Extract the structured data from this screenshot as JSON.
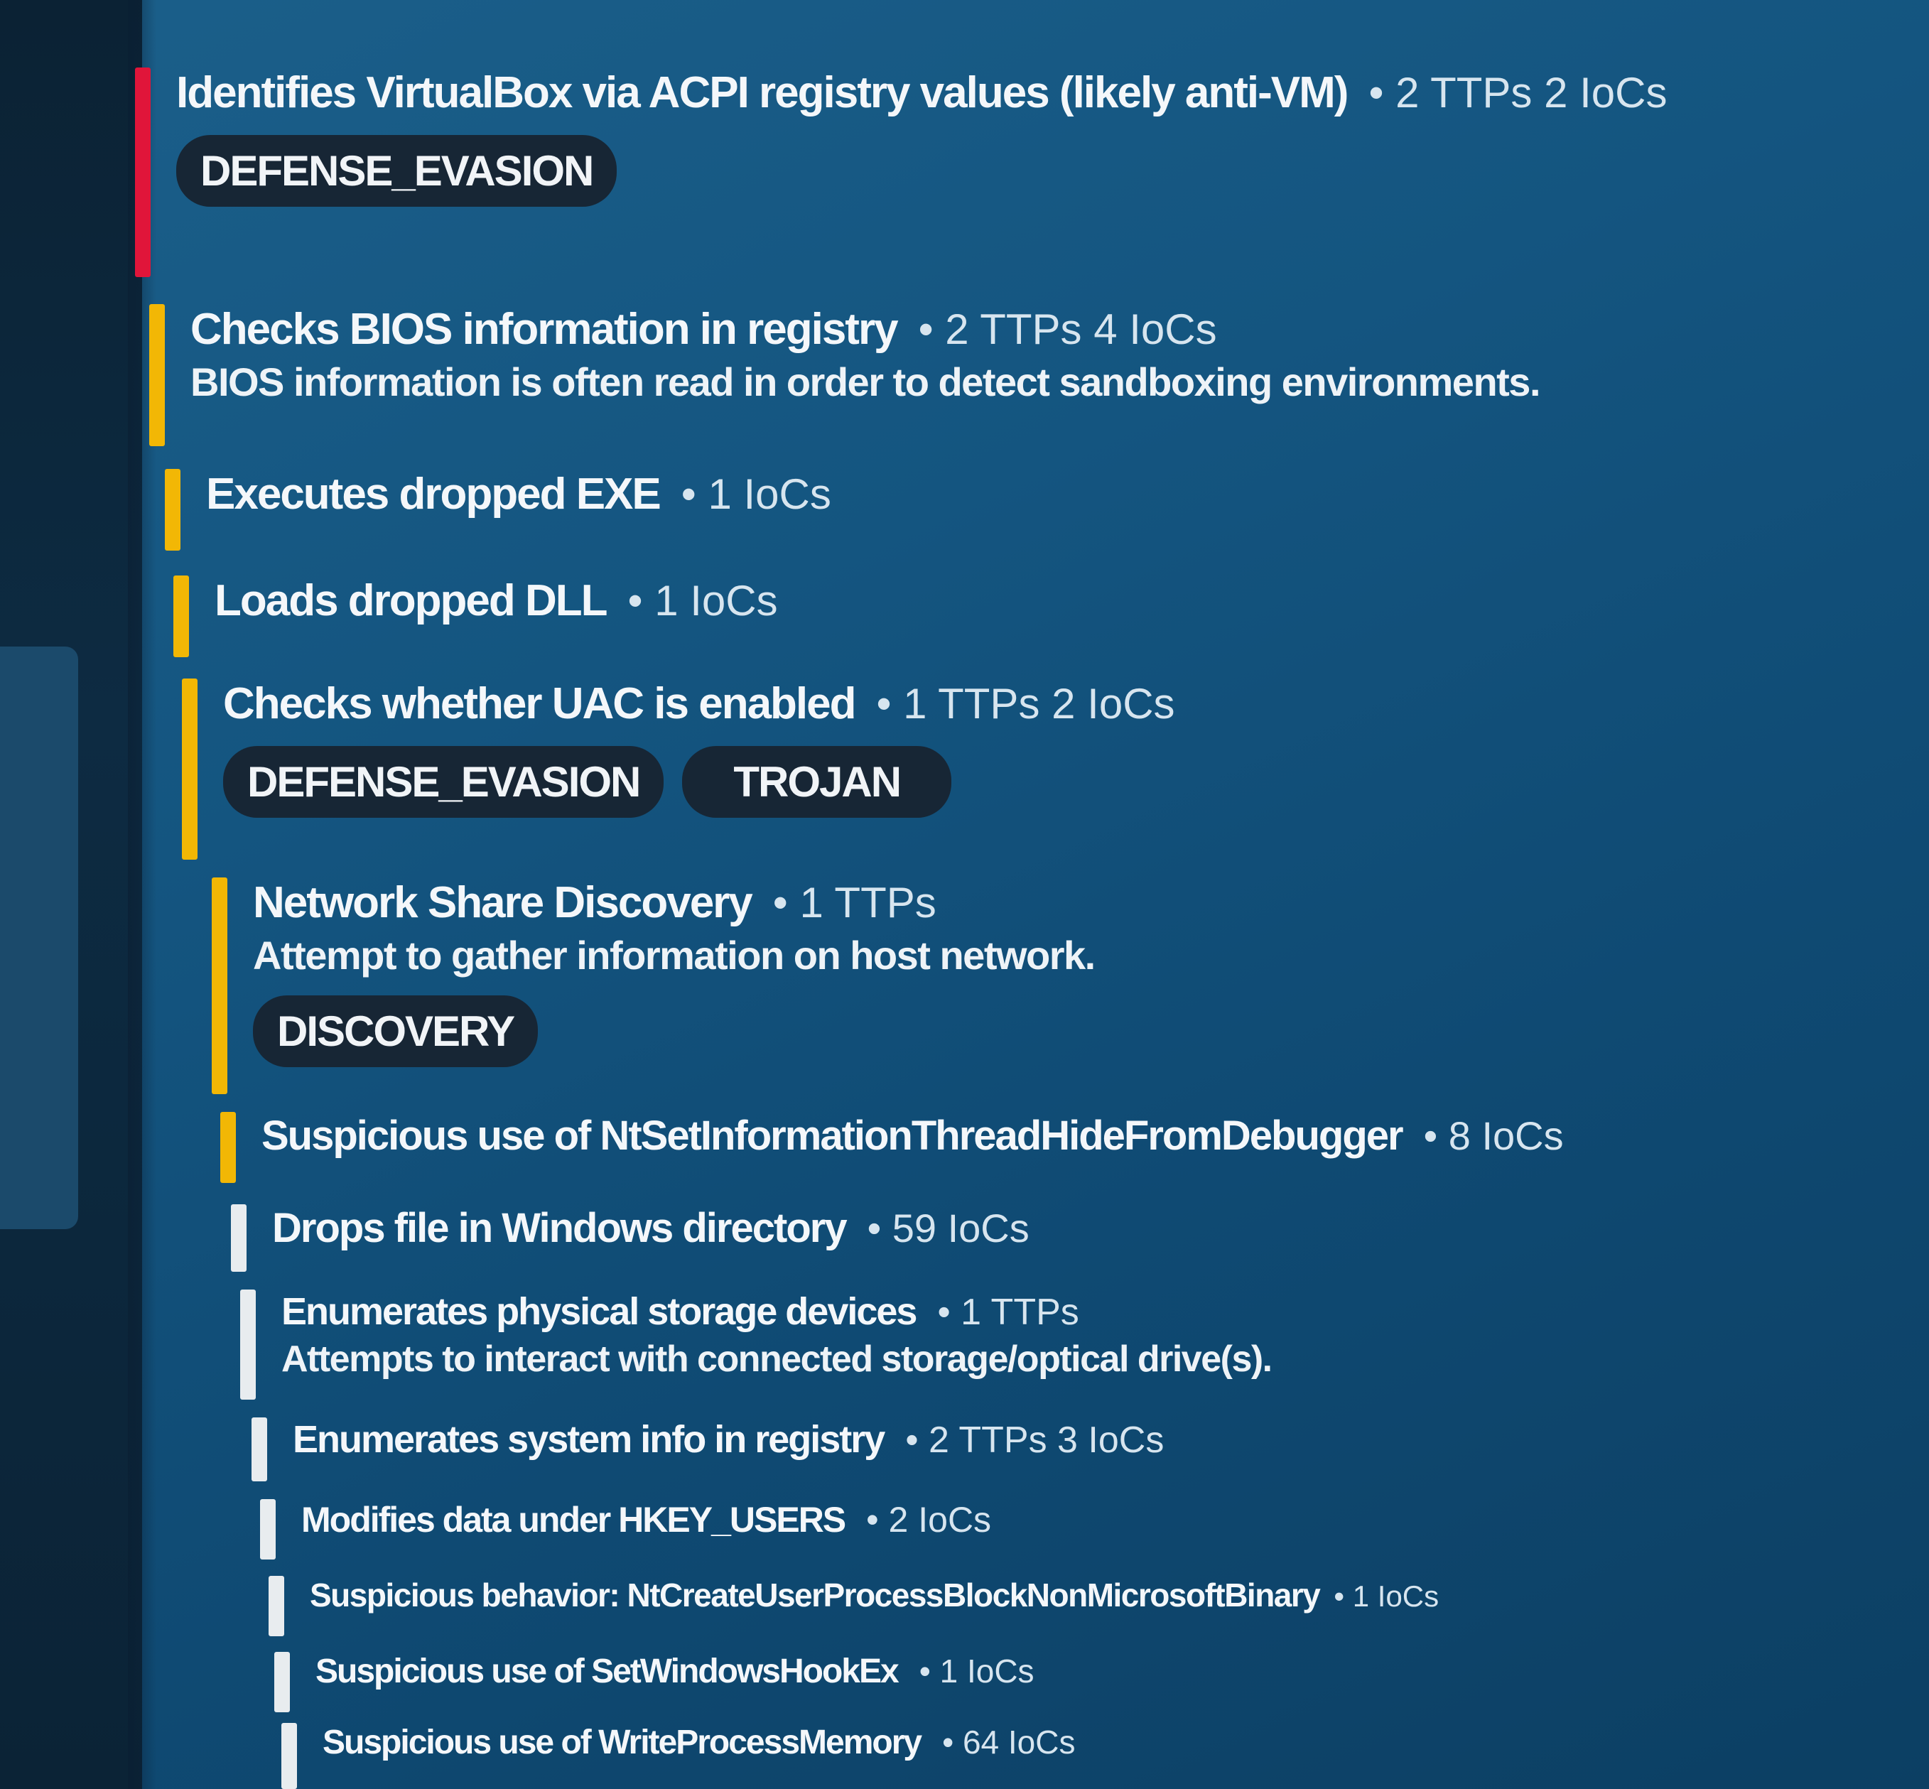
{
  "signatures": [
    {
      "title": "Identifies VirtualBox via ACPI registry values (likely anti-VM)",
      "meta": "• 2 TTPs 2 IoCs",
      "desc": "",
      "tags": [
        "DEFENSE_EVASION"
      ],
      "severity_color": "#e0153a"
    },
    {
      "title": "Checks BIOS information in registry",
      "meta": "• 2 TTPs 4 IoCs",
      "desc": "BIOS information is often read in order to detect sandboxing environments.",
      "tags": [],
      "severity_color": "#f2b705"
    },
    {
      "title": "Executes dropped EXE",
      "meta": "• 1 IoCs",
      "desc": "",
      "tags": [],
      "severity_color": "#f2b705"
    },
    {
      "title": "Loads dropped DLL",
      "meta": "• 1 IoCs",
      "desc": "",
      "tags": [],
      "severity_color": "#f2b705"
    },
    {
      "title": "Checks whether UAC is enabled",
      "meta": "• 1 TTPs 2 IoCs",
      "desc": "",
      "tags": [
        "DEFENSE_EVASION",
        "TROJAN"
      ],
      "severity_color": "#f2b705"
    },
    {
      "title": "Network Share Discovery",
      "meta": "• 1 TTPs",
      "desc": "Attempt to gather information on host network.",
      "tags": [
        "DISCOVERY"
      ],
      "severity_color": "#f2b705"
    },
    {
      "title": "Suspicious use of NtSetInformationThreadHideFromDebugger",
      "meta": "• 8 IoCs",
      "desc": "",
      "tags": [],
      "severity_color": "#f2b705"
    },
    {
      "title": "Drops file in Windows directory",
      "meta": "• 59 IoCs",
      "desc": "",
      "tags": [],
      "severity_color": "#e8ecef"
    },
    {
      "title": "Enumerates physical storage devices",
      "meta": "• 1 TTPs",
      "desc": "Attempts to interact with connected storage/optical drive(s).",
      "tags": [],
      "severity_color": "#e8ecef"
    },
    {
      "title": "Enumerates system info in registry",
      "meta": "• 2 TTPs 3 IoCs",
      "desc": "",
      "tags": [],
      "severity_color": "#e8ecef"
    },
    {
      "title": "Modifies data under HKEY_USERS",
      "meta": "• 2 IoCs",
      "desc": "",
      "tags": [],
      "severity_color": "#e8ecef"
    },
    {
      "title": "Suspicious behavior: NtCreateUserProcessBlockNonMicrosoftBinary",
      "meta": "• 1 IoCs",
      "desc": "",
      "tags": [],
      "severity_color": "#e8ecef"
    },
    {
      "title": "Suspicious use of SetWindowsHookEx",
      "meta": "• 1 IoCs",
      "desc": "",
      "tags": [],
      "severity_color": "#e8ecef"
    },
    {
      "title": "Suspicious use of WriteProcessMemory",
      "meta": "• 64 IoCs",
      "desc": "",
      "tags": [],
      "severity_color": "#e8ecef"
    }
  ]
}
